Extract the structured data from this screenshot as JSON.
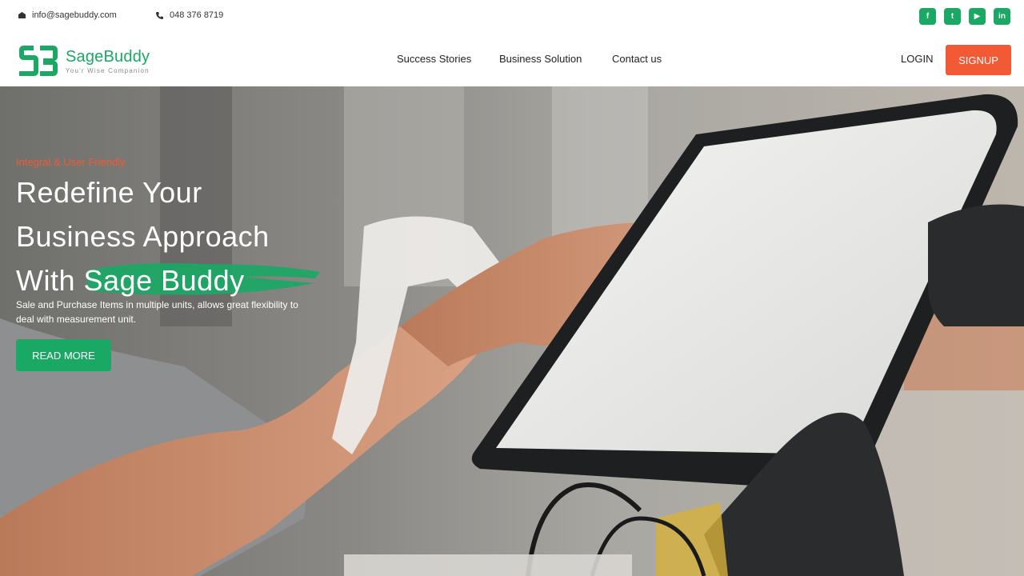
{
  "topbar": {
    "email": "info@sagebuddy.com",
    "phone": "048 376 8719",
    "email_icon": "mail-icon",
    "phone_icon": "phone-icon",
    "socials": [
      {
        "name": "facebook-icon",
        "glyph": "f"
      },
      {
        "name": "twitter-icon",
        "glyph": "t"
      },
      {
        "name": "youtube-icon",
        "glyph": "▶"
      },
      {
        "name": "linkedin-icon",
        "glyph": "in"
      }
    ]
  },
  "header": {
    "logo_name": "SageBuddy",
    "logo_tagline": "You'r Wise Companion",
    "nav": [
      "Success Stories",
      "Business Solution",
      "Contact us"
    ],
    "login_label": "LOGIN",
    "signup_label": "SIGNUP"
  },
  "hero": {
    "eyebrow": "Integral & User Friendly",
    "headline_line1": "Redefine Your",
    "headline_line2": "Business Approach",
    "headline_line3_prefix": "With ",
    "headline_highlight": "Sage Buddy",
    "description": "Sale and Purchase Items in multiple units, allows great flexibility to deal with measurement unit.",
    "cta_label": "READ MORE"
  },
  "colors": {
    "brand_green": "#1aa865",
    "accent_orange": "#f15a35"
  }
}
